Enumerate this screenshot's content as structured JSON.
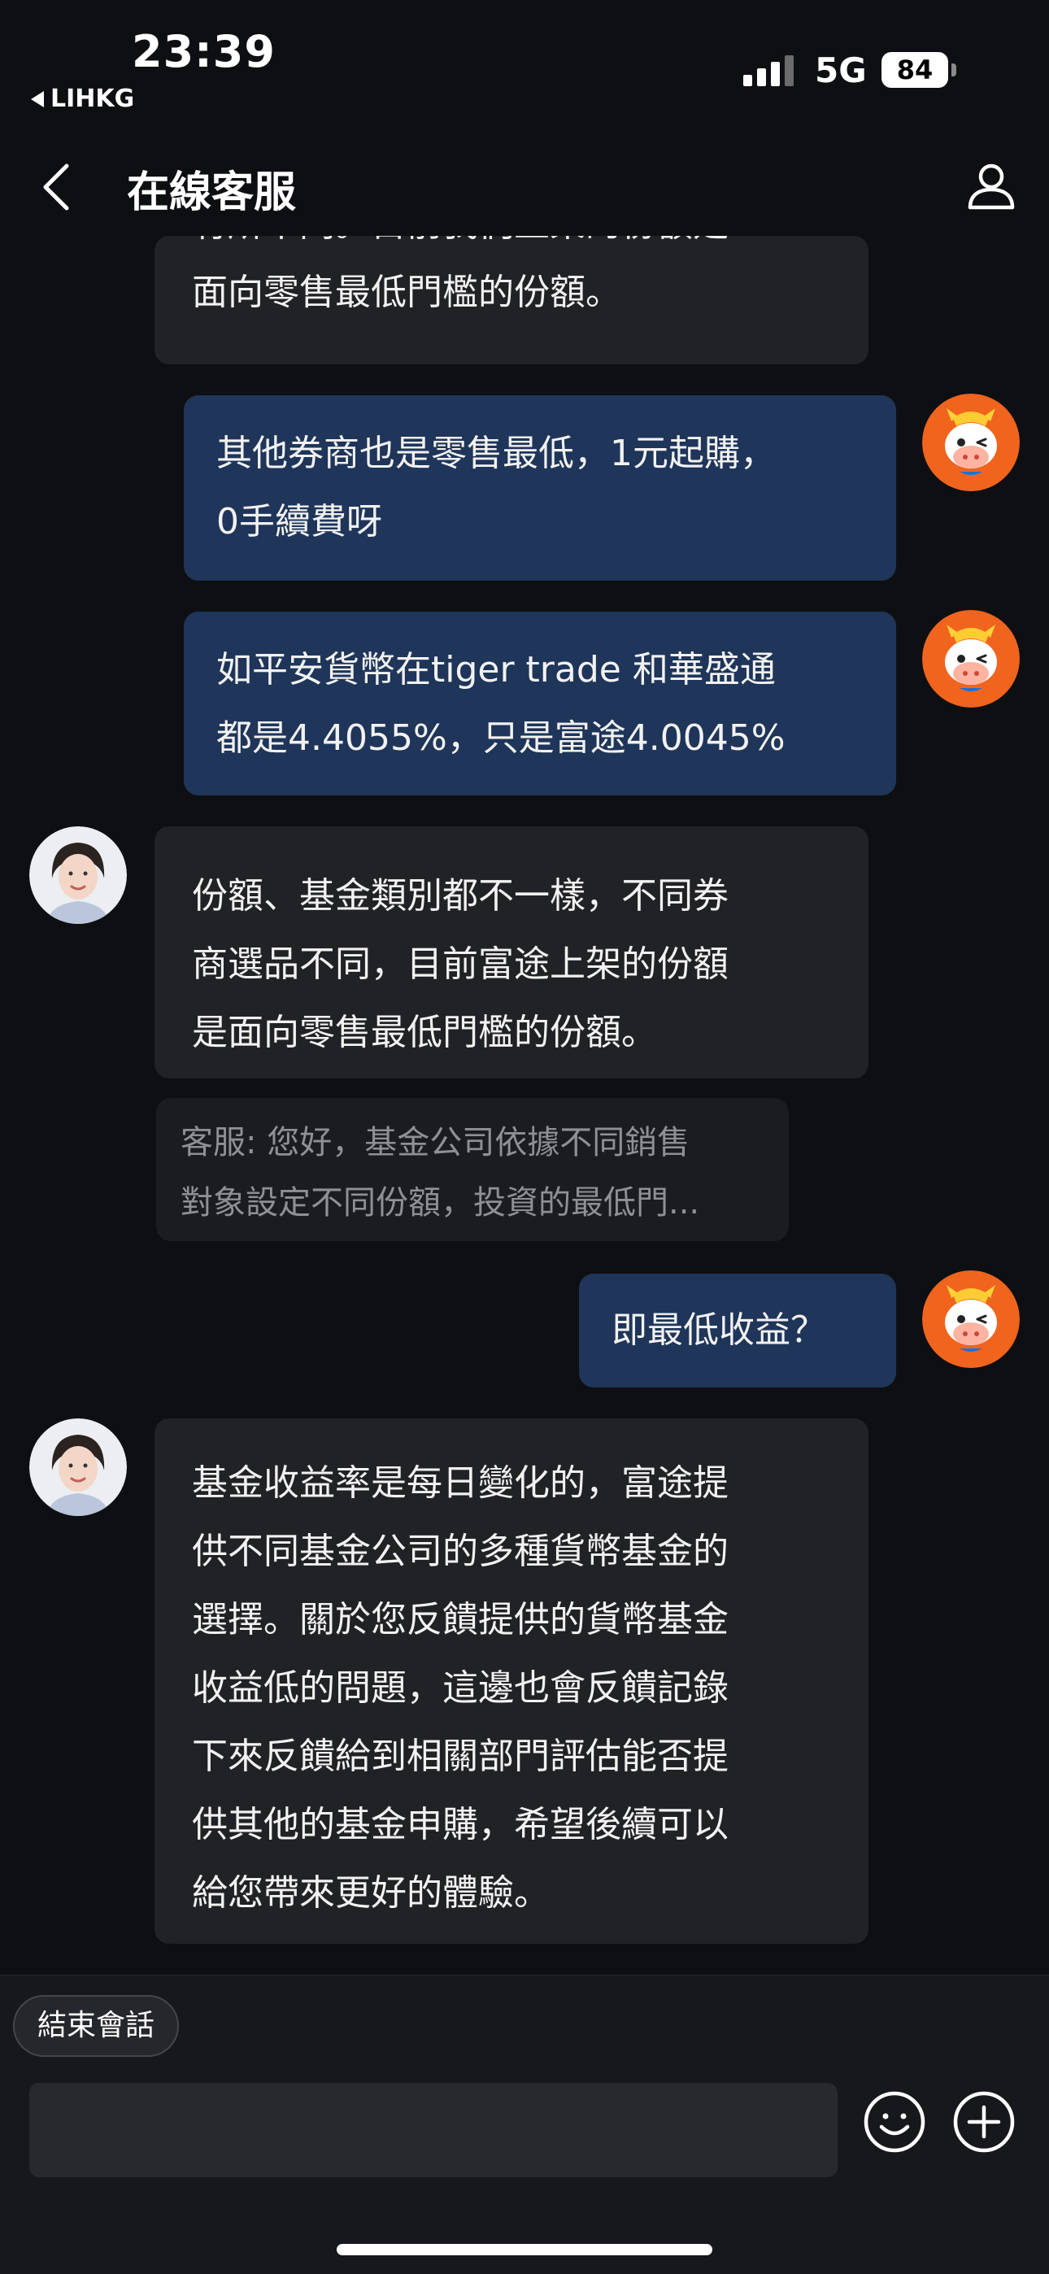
{
  "status_bar": {
    "time": "23:39",
    "back_app": "LIHKG",
    "network": "5G",
    "battery": "84"
  },
  "header": {
    "title": "在線客服"
  },
  "messages": {
    "m0": {
      "sender": "agent",
      "lines": [
        "有所不同。目前我們上架的份額是",
        "面向零售最低門檻的份額。"
      ]
    },
    "m1": {
      "sender": "user",
      "lines": [
        "其他券商也是零售最低，1元起購，",
        "0手續費呀"
      ]
    },
    "m2": {
      "sender": "user",
      "lines": [
        "如平安貨幣在tiger  trade  和華盛通",
        "都是4.4055%，只是富途4.0045%"
      ]
    },
    "m3": {
      "sender": "agent",
      "lines": [
        "份額、基金類別都不一樣，不同券",
        "商選品不同，目前富途上架的份額",
        "是面向零售最低門檻的份額。"
      ]
    },
    "quote": {
      "lines": [
        "客服: 您好，基金公司依據不同銷售",
        "對象設定不同份額，投資的最低門..."
      ]
    },
    "m4": {
      "sender": "user",
      "lines": [
        "即最低收益？"
      ]
    },
    "m5": {
      "sender": "agent",
      "lines": [
        "基金收益率是每日變化的，富途提",
        "供不同基金公司的多種貨幣基金的",
        "選擇。關於您反饋提供的貨幣基金",
        "收益低的問題，這邊也會反饋記錄",
        "下來反饋給到相關部門評估能否提",
        "供其他的基金申購，希望後續可以",
        "給您帶來更好的體驗。"
      ]
    }
  },
  "footer": {
    "end_session": "結束會話",
    "input_value": "",
    "input_placeholder": ""
  },
  "colors": {
    "background": "#0e0f12",
    "agent_bubble": "#212226",
    "user_bubble": "#1f3559",
    "user_avatar": "#f0641e"
  },
  "icons": [
    "back-icon",
    "profile-icon",
    "smiley-icon",
    "plus-icon",
    "agent-avatar",
    "user-avatar-bull"
  ]
}
